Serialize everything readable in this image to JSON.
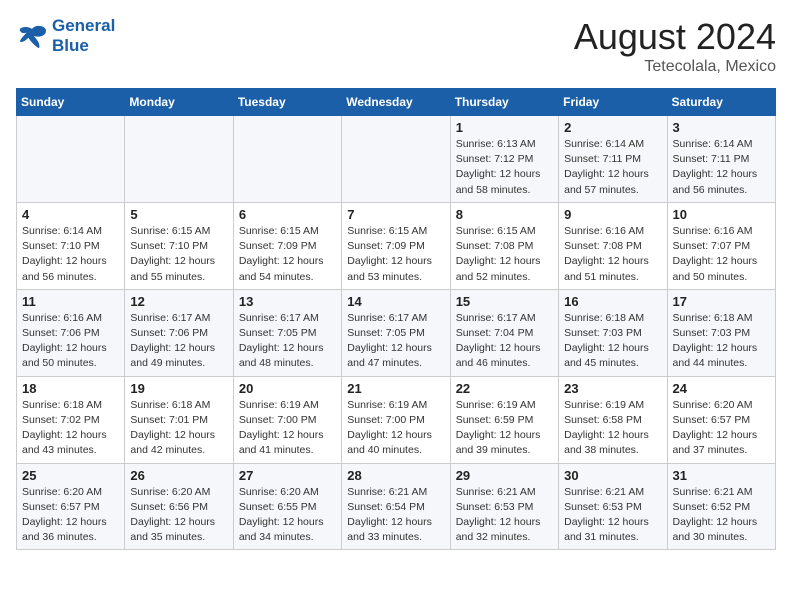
{
  "header": {
    "logo_line1": "General",
    "logo_line2": "Blue",
    "month_year": "August 2024",
    "location": "Tetecolala, Mexico"
  },
  "days_of_week": [
    "Sunday",
    "Monday",
    "Tuesday",
    "Wednesday",
    "Thursday",
    "Friday",
    "Saturday"
  ],
  "weeks": [
    [
      {
        "day": "",
        "info": ""
      },
      {
        "day": "",
        "info": ""
      },
      {
        "day": "",
        "info": ""
      },
      {
        "day": "",
        "info": ""
      },
      {
        "day": "1",
        "info": "Sunrise: 6:13 AM\nSunset: 7:12 PM\nDaylight: 12 hours\nand 58 minutes."
      },
      {
        "day": "2",
        "info": "Sunrise: 6:14 AM\nSunset: 7:11 PM\nDaylight: 12 hours\nand 57 minutes."
      },
      {
        "day": "3",
        "info": "Sunrise: 6:14 AM\nSunset: 7:11 PM\nDaylight: 12 hours\nand 56 minutes."
      }
    ],
    [
      {
        "day": "4",
        "info": "Sunrise: 6:14 AM\nSunset: 7:10 PM\nDaylight: 12 hours\nand 56 minutes."
      },
      {
        "day": "5",
        "info": "Sunrise: 6:15 AM\nSunset: 7:10 PM\nDaylight: 12 hours\nand 55 minutes."
      },
      {
        "day": "6",
        "info": "Sunrise: 6:15 AM\nSunset: 7:09 PM\nDaylight: 12 hours\nand 54 minutes."
      },
      {
        "day": "7",
        "info": "Sunrise: 6:15 AM\nSunset: 7:09 PM\nDaylight: 12 hours\nand 53 minutes."
      },
      {
        "day": "8",
        "info": "Sunrise: 6:15 AM\nSunset: 7:08 PM\nDaylight: 12 hours\nand 52 minutes."
      },
      {
        "day": "9",
        "info": "Sunrise: 6:16 AM\nSunset: 7:08 PM\nDaylight: 12 hours\nand 51 minutes."
      },
      {
        "day": "10",
        "info": "Sunrise: 6:16 AM\nSunset: 7:07 PM\nDaylight: 12 hours\nand 50 minutes."
      }
    ],
    [
      {
        "day": "11",
        "info": "Sunrise: 6:16 AM\nSunset: 7:06 PM\nDaylight: 12 hours\nand 50 minutes."
      },
      {
        "day": "12",
        "info": "Sunrise: 6:17 AM\nSunset: 7:06 PM\nDaylight: 12 hours\nand 49 minutes."
      },
      {
        "day": "13",
        "info": "Sunrise: 6:17 AM\nSunset: 7:05 PM\nDaylight: 12 hours\nand 48 minutes."
      },
      {
        "day": "14",
        "info": "Sunrise: 6:17 AM\nSunset: 7:05 PM\nDaylight: 12 hours\nand 47 minutes."
      },
      {
        "day": "15",
        "info": "Sunrise: 6:17 AM\nSunset: 7:04 PM\nDaylight: 12 hours\nand 46 minutes."
      },
      {
        "day": "16",
        "info": "Sunrise: 6:18 AM\nSunset: 7:03 PM\nDaylight: 12 hours\nand 45 minutes."
      },
      {
        "day": "17",
        "info": "Sunrise: 6:18 AM\nSunset: 7:03 PM\nDaylight: 12 hours\nand 44 minutes."
      }
    ],
    [
      {
        "day": "18",
        "info": "Sunrise: 6:18 AM\nSunset: 7:02 PM\nDaylight: 12 hours\nand 43 minutes."
      },
      {
        "day": "19",
        "info": "Sunrise: 6:18 AM\nSunset: 7:01 PM\nDaylight: 12 hours\nand 42 minutes."
      },
      {
        "day": "20",
        "info": "Sunrise: 6:19 AM\nSunset: 7:00 PM\nDaylight: 12 hours\nand 41 minutes."
      },
      {
        "day": "21",
        "info": "Sunrise: 6:19 AM\nSunset: 7:00 PM\nDaylight: 12 hours\nand 40 minutes."
      },
      {
        "day": "22",
        "info": "Sunrise: 6:19 AM\nSunset: 6:59 PM\nDaylight: 12 hours\nand 39 minutes."
      },
      {
        "day": "23",
        "info": "Sunrise: 6:19 AM\nSunset: 6:58 PM\nDaylight: 12 hours\nand 38 minutes."
      },
      {
        "day": "24",
        "info": "Sunrise: 6:20 AM\nSunset: 6:57 PM\nDaylight: 12 hours\nand 37 minutes."
      }
    ],
    [
      {
        "day": "25",
        "info": "Sunrise: 6:20 AM\nSunset: 6:57 PM\nDaylight: 12 hours\nand 36 minutes."
      },
      {
        "day": "26",
        "info": "Sunrise: 6:20 AM\nSunset: 6:56 PM\nDaylight: 12 hours\nand 35 minutes."
      },
      {
        "day": "27",
        "info": "Sunrise: 6:20 AM\nSunset: 6:55 PM\nDaylight: 12 hours\nand 34 minutes."
      },
      {
        "day": "28",
        "info": "Sunrise: 6:21 AM\nSunset: 6:54 PM\nDaylight: 12 hours\nand 33 minutes."
      },
      {
        "day": "29",
        "info": "Sunrise: 6:21 AM\nSunset: 6:53 PM\nDaylight: 12 hours\nand 32 minutes."
      },
      {
        "day": "30",
        "info": "Sunrise: 6:21 AM\nSunset: 6:53 PM\nDaylight: 12 hours\nand 31 minutes."
      },
      {
        "day": "31",
        "info": "Sunrise: 6:21 AM\nSunset: 6:52 PM\nDaylight: 12 hours\nand 30 minutes."
      }
    ]
  ]
}
